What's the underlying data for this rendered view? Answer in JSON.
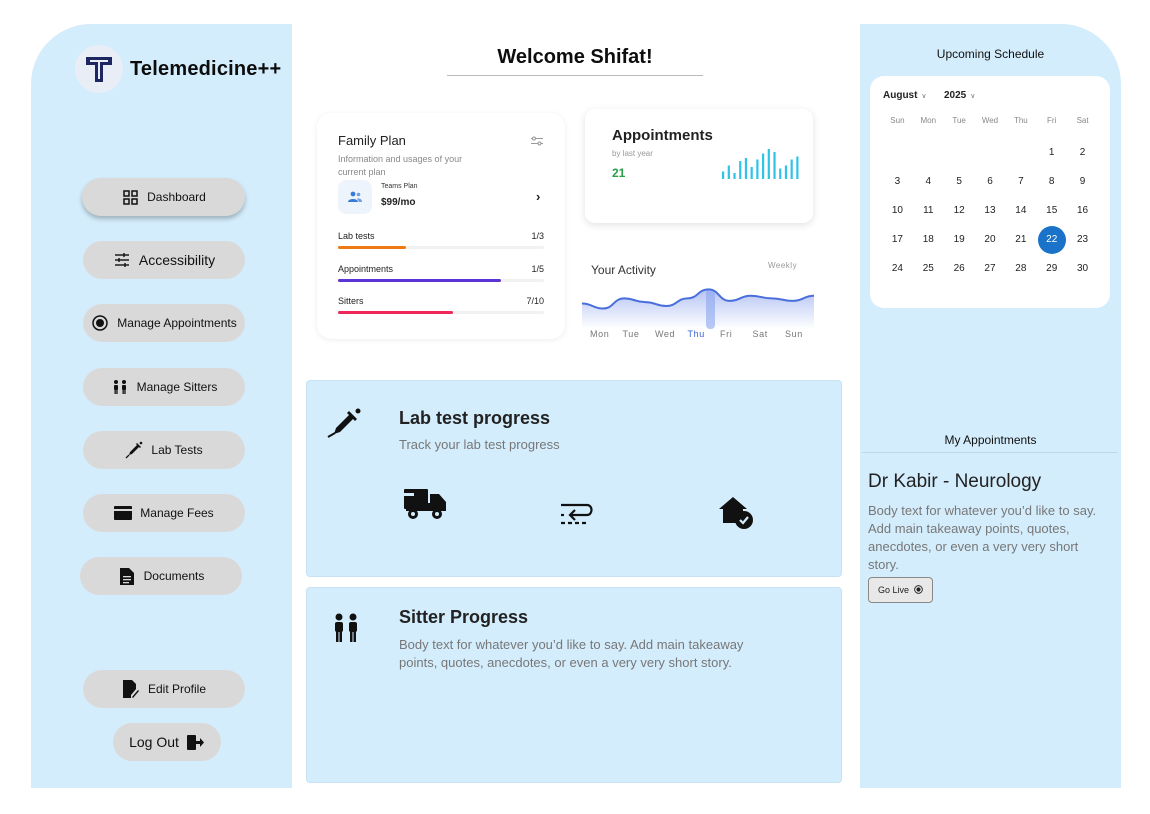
{
  "app": {
    "name": "Telemedicine++",
    "logo_letter": "T"
  },
  "sidebar": {
    "items": [
      {
        "label": "Dashboard",
        "icon": "grid-icon"
      },
      {
        "label": "Accessibility",
        "icon": "sliders-icon"
      },
      {
        "label": "Manage Appointments",
        "icon": "radio-icon"
      },
      {
        "label": "Manage Sitters",
        "icon": "people-icon"
      },
      {
        "label": "Lab Tests",
        "icon": "syringe-icon"
      },
      {
        "label": "Manage Fees",
        "icon": "card-icon"
      },
      {
        "label": "Documents",
        "icon": "document-icon"
      }
    ],
    "edit_profile": "Edit Profile",
    "logout": "Log Out"
  },
  "header": {
    "welcome": "Welcome Shifat!"
  },
  "plan": {
    "title": "Family Plan",
    "subtitle": "Information and usages of your current plan",
    "plan_name": "Teams Plan",
    "price": "$99/mo",
    "usage": [
      {
        "label": "Lab tests",
        "value": "1/3",
        "fraction": 0.33,
        "color": "#f07a12"
      },
      {
        "label": "Appointments",
        "value": "1/5",
        "fraction": 0.79,
        "color": "#5c34d6"
      },
      {
        "label": "Sitters",
        "value": "7/10",
        "fraction": 0.56,
        "color": "#f0285a"
      }
    ]
  },
  "appointments_card": {
    "title": "Appointments",
    "subtitle": "by last year",
    "count": "21",
    "bars": [
      5,
      9,
      4,
      12,
      14,
      8,
      13,
      17,
      20,
      18,
      7,
      9,
      13,
      15
    ],
    "bar_color": "#2fc3e8"
  },
  "activity": {
    "title": "Your Activity",
    "period": "Weekly",
    "days": [
      "Mon",
      "Tue",
      "Wed",
      "Thu",
      "Fri",
      "Sat",
      "Sun"
    ],
    "selected_day": "Thu",
    "values": [
      20,
      16,
      24,
      21,
      18,
      24,
      31,
      22,
      26,
      24,
      22,
      26
    ],
    "line_color": "#4a6fdc"
  },
  "lab_panel": {
    "title": "Lab test progress",
    "subtitle": "Track your lab test progress",
    "steps": [
      "truck-icon",
      "exchange-icon",
      "home-check-icon"
    ]
  },
  "sitter_panel": {
    "title": "Sitter Progress",
    "body": "Body text for whatever you’d like to say. Add main takeaway points, quotes, anecdotes, or even a very very short story."
  },
  "schedule": {
    "title": "Upcoming Schedule",
    "month": "August",
    "year": "2025",
    "weekdays": [
      "Sun",
      "Mon",
      "Tue",
      "Wed",
      "Thu",
      "Fri",
      "Sat"
    ],
    "weeks": [
      [
        "",
        "",
        "",
        "",
        "",
        "1",
        "2"
      ],
      [
        "3",
        "4",
        "5",
        "6",
        "7",
        "8",
        "9"
      ],
      [
        "10",
        "11",
        "12",
        "13",
        "14",
        "15",
        "16"
      ],
      [
        "17",
        "18",
        "19",
        "20",
        "21",
        "22",
        "23"
      ],
      [
        "24",
        "25",
        "26",
        "27",
        "28",
        "29",
        "30"
      ]
    ],
    "selected": "22"
  },
  "my_appointments": {
    "title": "My Appointments",
    "doctor": "Dr Kabir - Neurology",
    "body": "Body text for whatever you’d like to say. Add main takeaway points, quotes, anecdotes, or even a very very short story.",
    "button": "Go Live"
  }
}
